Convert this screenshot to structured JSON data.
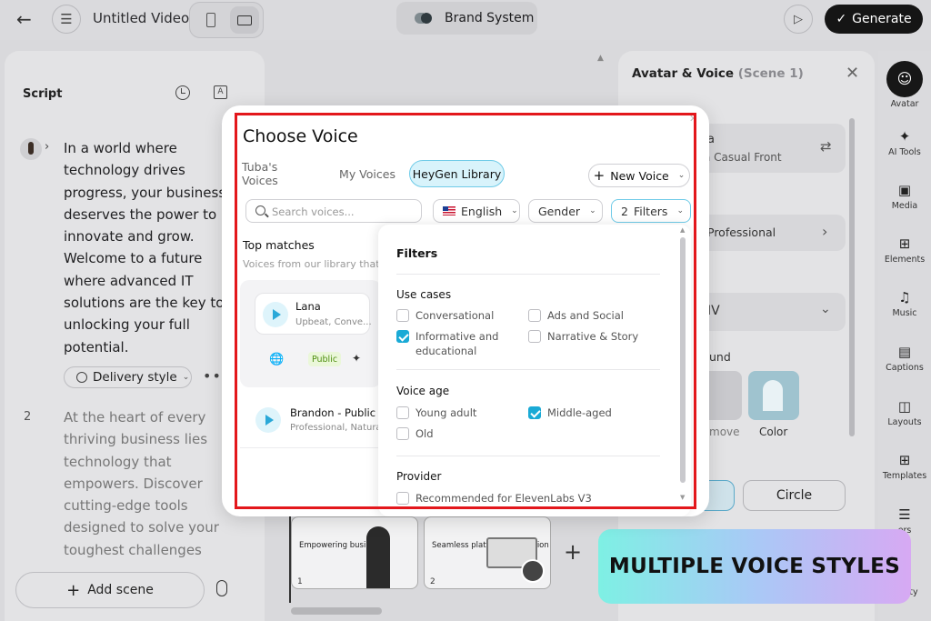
{
  "topbar": {
    "title": "Untitled Video",
    "brand": "Brand System",
    "generate": "Generate"
  },
  "script": {
    "title": "Script",
    "scene1_text": "In a world where technology drives progress, your business deserves the power to innovate and grow. Welcome to a future where advanced IT solutions are the key to unlocking your full potential.",
    "delivery_style": "Delivery style",
    "scene2_number": "2",
    "scene2_text": "At the heart of every thriving business lies technology that empowers. Discover cutting-edge tools designed to solve your toughest challenges",
    "add_scene": "Add scene"
  },
  "timeline": {
    "thumbs": [
      {
        "title": "Empowering business",
        "number": "1"
      },
      {
        "title": "Seamless platform integration",
        "number": "2"
      }
    ]
  },
  "right_panel": {
    "title": "Avatar & Voice",
    "scene_tag": "(Scene 1)",
    "card1_line1": "a",
    "card1_line2": "a Casual Front",
    "card2": "Professional",
    "card3": "IV",
    "background_label": "und",
    "remove": "move",
    "color": "Color",
    "circle": "Circle"
  },
  "toolbar": {
    "items": [
      {
        "label": "Avatar",
        "icon": "avatar-icon"
      },
      {
        "label": "AI Tools",
        "icon": "sparkle-icon"
      },
      {
        "label": "Media",
        "icon": "image-icon"
      },
      {
        "label": "Elements",
        "icon": "elements-icon"
      },
      {
        "label": "Music",
        "icon": "music-icon"
      },
      {
        "label": "Captions",
        "icon": "captions-icon"
      },
      {
        "label": "Layouts",
        "icon": "layout-icon"
      },
      {
        "label": "Templates",
        "icon": "template-icon"
      },
      {
        "label": "ers",
        "icon": "layers-icon"
      },
      {
        "label": "ctivity",
        "icon": "activity-icon"
      }
    ]
  },
  "banner": {
    "text": "MULTIPLE VOICE STYLES",
    "gradient_start": "#7ef0e4",
    "gradient_end": "#d7a9f3"
  },
  "modal": {
    "title": "Choose Voice",
    "tabs": [
      "Tuba's Voices",
      "My Voices",
      "HeyGen Library"
    ],
    "active_tab": "HeyGen Library",
    "new_voice": "New Voice",
    "search_placeholder": "Search voices...",
    "language": "English",
    "gender": "Gender",
    "filters_count": "2",
    "filters_label": "Filters",
    "top_matches": "Top matches",
    "top_matches_sub": "Voices from our library that be",
    "voices": [
      {
        "name": "Lana",
        "desc": "Upbeat, Conve...",
        "badge": "Public"
      },
      {
        "name": "Brandon - Public",
        "desc": "Professional, Natural, E"
      }
    ],
    "frame_color": "#e3171c",
    "accent_color": "#1aaad6"
  },
  "filters": {
    "title": "Filters",
    "use_cases_label": "Use cases",
    "use_cases": [
      {
        "label": "Conversational",
        "checked": false
      },
      {
        "label": "Ads and Social",
        "checked": false
      },
      {
        "label": "Informative and educational",
        "checked": true
      },
      {
        "label": "Narrative & Story",
        "checked": false
      }
    ],
    "voice_age_label": "Voice age",
    "voice_age": [
      {
        "label": "Young adult",
        "checked": false
      },
      {
        "label": "Middle-aged",
        "checked": true
      },
      {
        "label": "Old",
        "checked": false
      }
    ],
    "provider_label": "Provider",
    "provider": [
      {
        "label": "Recommended for ElevenLabs V3",
        "checked": false
      }
    ]
  }
}
